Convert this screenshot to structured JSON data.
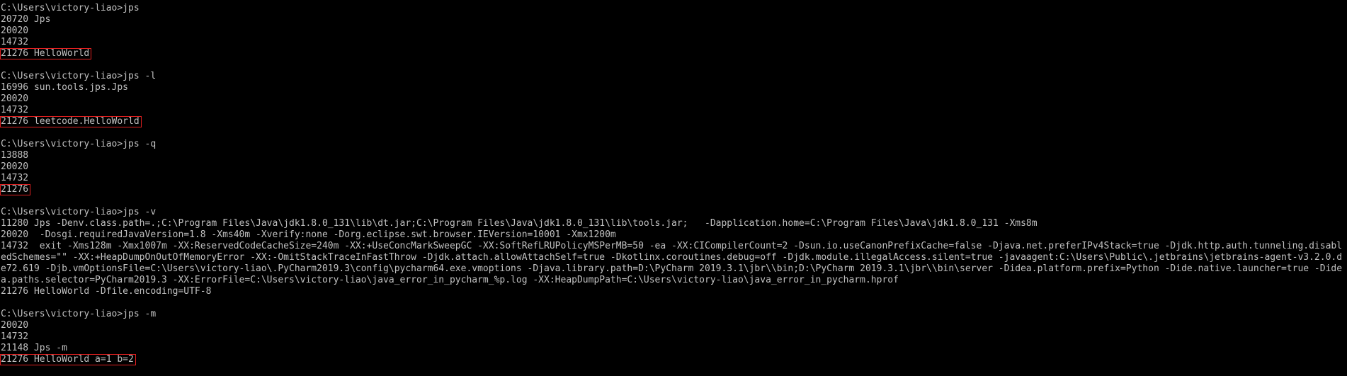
{
  "console": {
    "highlight_color": "#e02020",
    "text_color": "#c0c0c0",
    "background_color": "#000000",
    "blocks": [
      {
        "prompt": "C:\\Users\\victory-liao>jps",
        "lines": [
          "20720 Jps",
          "20020",
          "14732"
        ],
        "highlight": "21276 HelloWorld"
      },
      {
        "prompt": "C:\\Users\\victory-liao>jps -l",
        "lines": [
          "16996 sun.tools.jps.Jps",
          "20020",
          "14732"
        ],
        "highlight": "21276 leetcode.HelloWorld"
      },
      {
        "prompt": "C:\\Users\\victory-liao>jps -q",
        "lines": [
          "13888",
          "20020",
          "14732"
        ],
        "highlight": "21276"
      },
      {
        "prompt": "C:\\Users\\victory-liao>jps -v",
        "lines": [
          "11280 Jps -Denv.class.path=.;C:\\Program Files\\Java\\jdk1.8.0_131\\lib\\dt.jar;C:\\Program Files\\Java\\jdk1.8.0_131\\lib\\tools.jar;   -Dapplication.home=C:\\Program Files\\Java\\jdk1.8.0_131 -Xms8m",
          "20020  -Dosgi.requiredJavaVersion=1.8 -Xms40m -Xverify:none -Dorg.eclipse.swt.browser.IEVersion=10001 -Xmx1200m",
          "14732  exit -Xms128m -Xmx1007m -XX:ReservedCodeCacheSize=240m -XX:+UseConcMarkSweepGC -XX:SoftRefLRUPolicyMSPerMB=50 -ea -XX:CICompilerCount=2 -Dsun.io.useCanonPrefixCache=false -Djava.net.preferIPv4Stack=true -Djdk.http.auth.tunneling.disabledSchemes=\"\" -XX:+HeapDumpOnOutOfMemoryError -XX:-OmitStackTraceInFastThrow -Djdk.attach.allowAttachSelf=true -Dkotlinx.coroutines.debug=off -Djdk.module.illegalAccess.silent=true -javaagent:C:\\Users\\Public\\.jetbrains\\jetbrains-agent-v3.2.0.de72.619 -Djb.vmOptionsFile=C:\\Users\\victory-liao\\.PyCharm2019.3\\config\\pycharm64.exe.vmoptions -Djava.library.path=D:\\PyCharm 2019.3.1\\jbr\\\\bin;D:\\PyCharm 2019.3.1\\jbr\\\\bin\\server -Didea.platform.prefix=Python -Dide.native.launcher=true -Didea.paths.selector=PyCharm2019.3 -XX:ErrorFile=C:\\Users\\victory-liao\\java_error_in_pycharm_%p.log -XX:HeapDumpPath=C:\\Users\\victory-liao\\java_error_in_pycharm.hprof",
          "21276 HelloWorld -Dfile.encoding=UTF-8"
        ]
      },
      {
        "prompt": "C:\\Users\\victory-liao>jps -m",
        "lines": [
          "20020",
          "14732",
          "21148 Jps -m"
        ],
        "highlight": "21276 HelloWorld a=1 b=2"
      }
    ]
  }
}
